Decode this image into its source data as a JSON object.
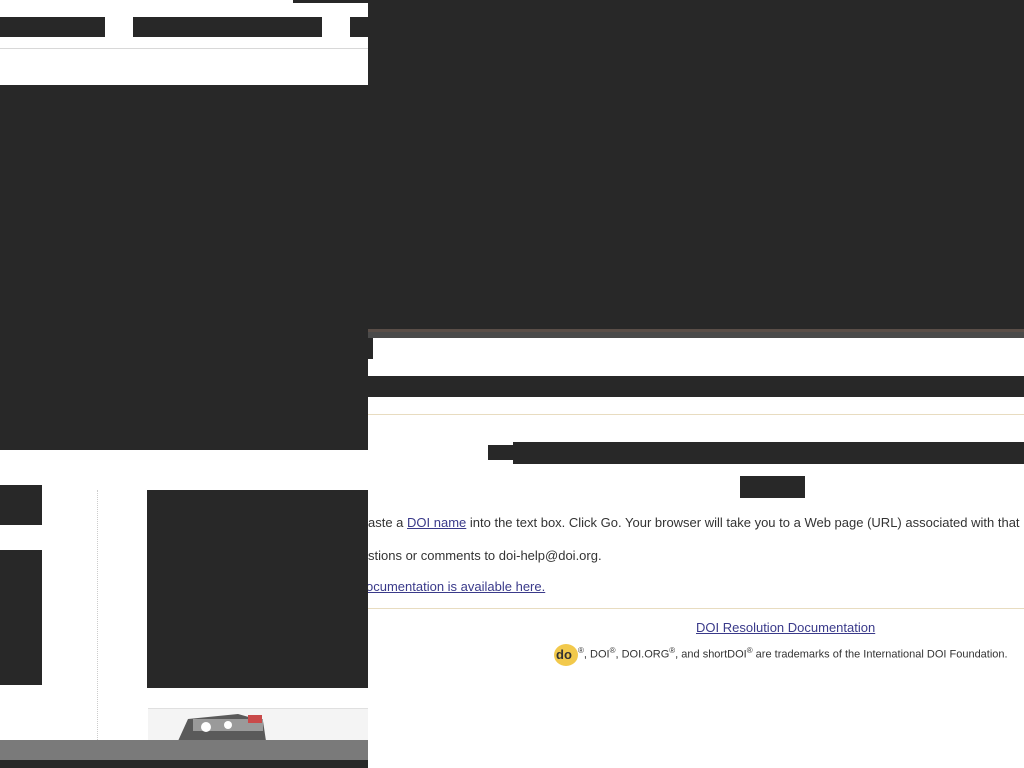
{
  "instructions": {
    "prefix": "aste a ",
    "doi_link": "DOI name",
    "suffix": " into the text box. Click Go. Your browser will take you to a Web page (URL) associated with that D"
  },
  "contact": "stions or comments to doi-help@doi.org.",
  "docs_link": "ocumentation is available here.",
  "footer": {
    "resolution_link": "DOI Resolution Documentation",
    "logo_text": "do",
    "reg": "®",
    "t1": ", DOI",
    "t2": ", DOI.ORG",
    "t3": ", and shortDOI",
    "t4": " are trademarks of the International DOI Foundation."
  },
  "colors": {
    "dark_bg": "#282828",
    "link": "#3a3a8a",
    "rule": "#e8dcc0",
    "logo": "#f2c94c"
  }
}
